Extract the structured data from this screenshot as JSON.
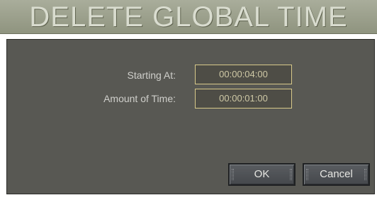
{
  "dialog": {
    "title": "DELETE GLOBAL TIME"
  },
  "fields": {
    "starting_at": {
      "label": "Starting At:",
      "value": "00:00:04:00"
    },
    "amount_of_time": {
      "label": "Amount of Time:",
      "value": "00:00:01:00"
    }
  },
  "buttons": {
    "ok_label": "OK",
    "cancel_label": "Cancel"
  },
  "colors": {
    "title_bar": "#8f947f",
    "panel": "#585853",
    "field_border": "#d8c98a"
  }
}
